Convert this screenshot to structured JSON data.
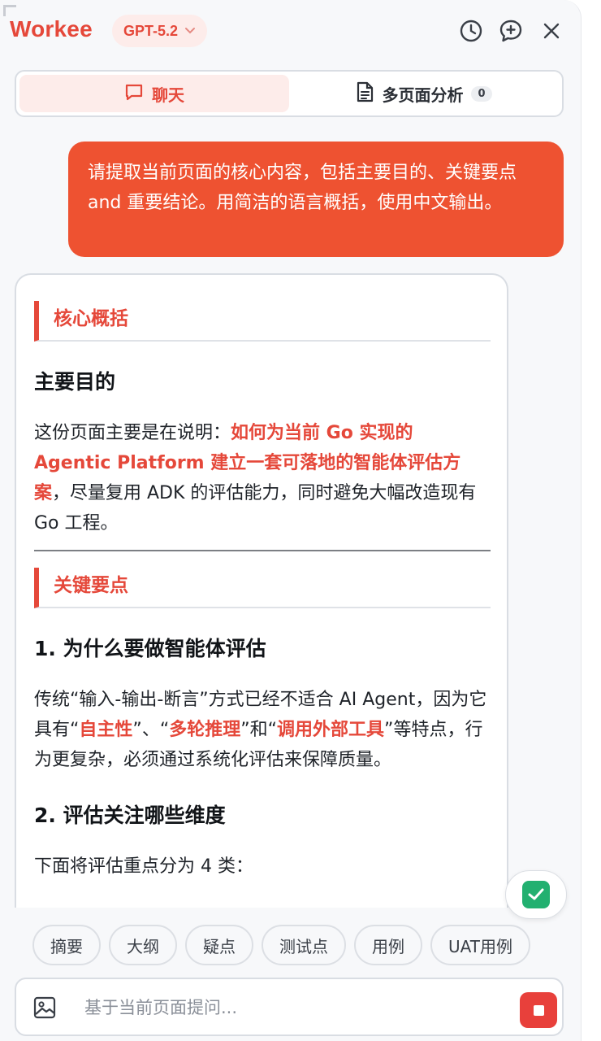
{
  "header": {
    "logo": "Workee",
    "model": "GPT-5.2",
    "icons": [
      "history-icon",
      "new-chat-icon",
      "close-icon"
    ]
  },
  "tabs": [
    {
      "label": "聊天",
      "icon": "chat-bubble-icon",
      "active": true
    },
    {
      "label": "多页面分析",
      "icon": "document-icon",
      "count": "0",
      "active": false
    }
  ],
  "user_message": "请提取当前页面的核心内容，包括主要目的、关键要点 and 重要结论。用简洁的语言概括，使用中文输出。",
  "answer": {
    "sec1_title": "核心概括",
    "purpose_title": "主要目的",
    "purpose_pre": "这份页面主要是在说明：",
    "purpose_hl": "如何为当前 Go 实现的 Agentic Platform 建立一套可落地的智能体评估方案",
    "purpose_post": "，尽量复用 ADK 的评估能力，同时避免大幅改造现有 Go 工程。",
    "sec2_title": "关键要点",
    "point1_title": "1. 为什么要做智能体评估",
    "point1_pre": "传统“输入-输出-断言”方式已经不适合 AI Agent，因为它具有“",
    "point1_hl1": "自主性",
    "point1_mid1": "”、“",
    "point1_hl2": "多轮推理",
    "point1_mid2": "”和“",
    "point1_hl3": "调用外部工具",
    "point1_post": "”等特点，行为更复杂，必须通过系统化评估来保障质量。",
    "point2_title": "2. 评估关注哪些维度",
    "point2_partial": "下面将评估重点分为 4 类："
  },
  "quick_actions": [
    "摘要",
    "大纲",
    "疑点",
    "测试点",
    "用例",
    "UAT用例"
  ],
  "input": {
    "placeholder": "基于当前页面提问..."
  },
  "colors": {
    "accent": "#e5483a",
    "user_bubble": "#ee5231",
    "success": "#22b070"
  }
}
